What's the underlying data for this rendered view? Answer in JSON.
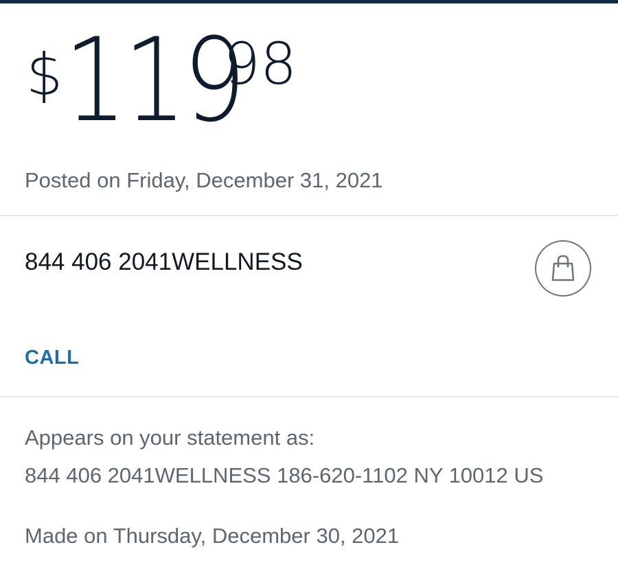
{
  "transaction": {
    "amount": {
      "currency_symbol": "$",
      "dollars": "119",
      "cents": "98"
    },
    "posted_date": "Posted on Friday, December 31, 2021",
    "merchant": {
      "name": "844 406 2041WELLNESS",
      "category_icon": "shopping-bag-icon"
    },
    "call_label": "CALL",
    "statement": {
      "label": "Appears on your statement as:",
      "value": "844 406 2041WELLNESS 186-620-1102 NY 10012 US"
    },
    "made_date": "Made on Thursday, December 30, 2021"
  },
  "colors": {
    "header_bar": "#0e2a40",
    "amount_text": "#0f1c2e",
    "secondary_text": "#5e6670",
    "link": "#1f6fa6",
    "divider": "#e3e5e8",
    "icon_stroke": "#6d737a"
  }
}
